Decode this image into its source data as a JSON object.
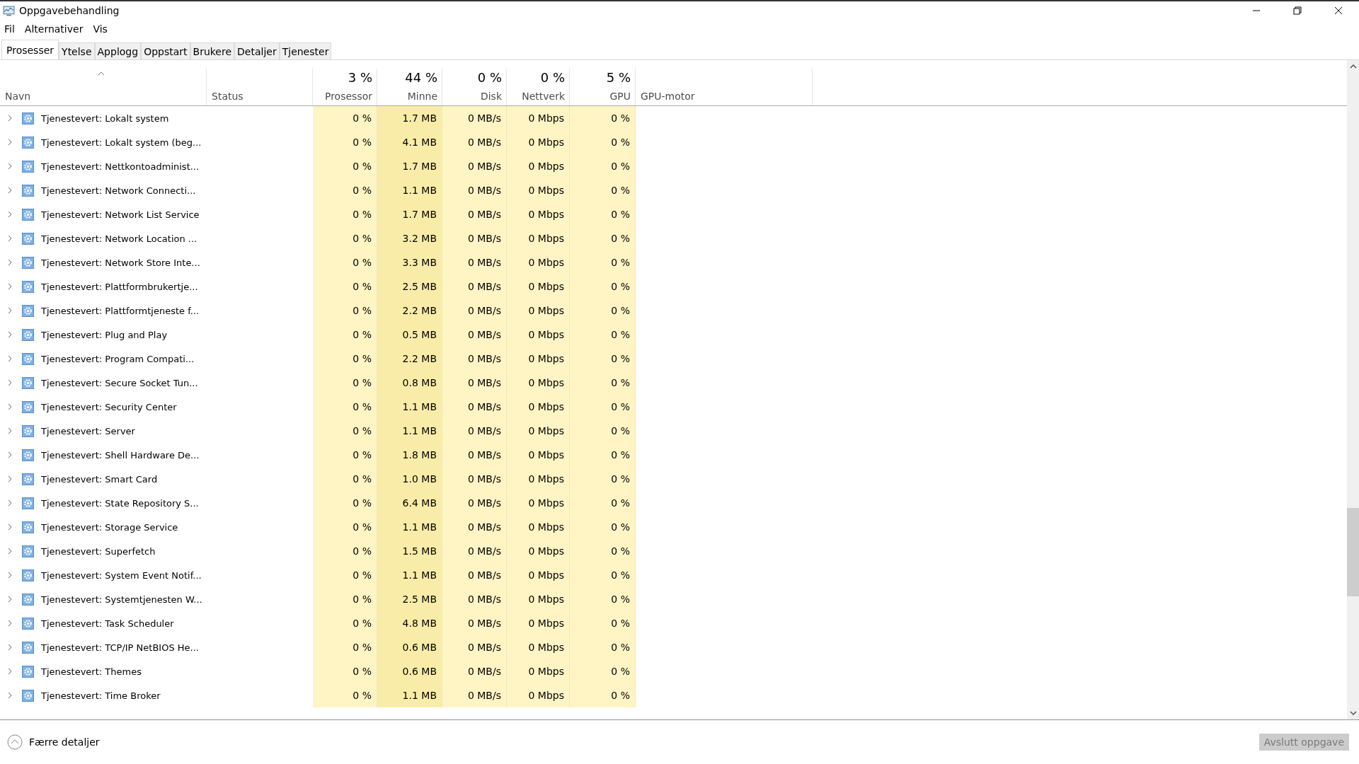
{
  "window": {
    "title": "Oppgavebehandling"
  },
  "menu": [
    "Fil",
    "Alternativer",
    "Vis"
  ],
  "tabs": [
    {
      "label": "Prosesser",
      "selected": true
    },
    {
      "label": "Ytelse",
      "selected": false
    },
    {
      "label": "Applogg",
      "selected": false
    },
    {
      "label": "Oppstart",
      "selected": false
    },
    {
      "label": "Brukere",
      "selected": false
    },
    {
      "label": "Detaljer",
      "selected": false
    },
    {
      "label": "Tjenester",
      "selected": false
    }
  ],
  "columns": [
    {
      "label": "Navn",
      "kind": "name"
    },
    {
      "label": "Status",
      "kind": "text"
    },
    {
      "usage": "3 %",
      "label": "Prosessor",
      "kind": "metric"
    },
    {
      "usage": "44 %",
      "label": "Minne",
      "kind": "metric"
    },
    {
      "usage": "0 %",
      "label": "Disk",
      "kind": "metric"
    },
    {
      "usage": "0 %",
      "label": "Nettverk",
      "kind": "metric"
    },
    {
      "usage": "5 %",
      "label": "GPU",
      "kind": "metric"
    },
    {
      "label": "GPU-motor",
      "kind": "text"
    }
  ],
  "rows": [
    {
      "name": "Tjenestevert: Lokalt system",
      "values": [
        "0 %",
        "1.7 MB",
        "0 MB/s",
        "0 Mbps",
        "0 %"
      ]
    },
    {
      "name": "Tjenestevert: Lokalt system (beg...",
      "values": [
        "0 %",
        "4.1 MB",
        "0 MB/s",
        "0 Mbps",
        "0 %"
      ]
    },
    {
      "name": "Tjenestevert: Nettkontoadminist...",
      "values": [
        "0 %",
        "1.7 MB",
        "0 MB/s",
        "0 Mbps",
        "0 %"
      ]
    },
    {
      "name": "Tjenestevert: Network Connecti...",
      "values": [
        "0 %",
        "1.1 MB",
        "0 MB/s",
        "0 Mbps",
        "0 %"
      ]
    },
    {
      "name": "Tjenestevert: Network List Service",
      "values": [
        "0 %",
        "1.7 MB",
        "0 MB/s",
        "0 Mbps",
        "0 %"
      ]
    },
    {
      "name": "Tjenestevert: Network Location ...",
      "values": [
        "0 %",
        "3.2 MB",
        "0 MB/s",
        "0 Mbps",
        "0 %"
      ]
    },
    {
      "name": "Tjenestevert: Network Store Inte...",
      "values": [
        "0 %",
        "3.3 MB",
        "0 MB/s",
        "0 Mbps",
        "0 %"
      ]
    },
    {
      "name": "Tjenestevert: Plattformbrukertje...",
      "values": [
        "0 %",
        "2.5 MB",
        "0 MB/s",
        "0 Mbps",
        "0 %"
      ]
    },
    {
      "name": "Tjenestevert: Plattformtjeneste f...",
      "values": [
        "0 %",
        "2.2 MB",
        "0 MB/s",
        "0 Mbps",
        "0 %"
      ]
    },
    {
      "name": "Tjenestevert: Plug and Play",
      "values": [
        "0 %",
        "0.5 MB",
        "0 MB/s",
        "0 Mbps",
        "0 %"
      ]
    },
    {
      "name": "Tjenestevert: Program Compati...",
      "values": [
        "0 %",
        "2.2 MB",
        "0 MB/s",
        "0 Mbps",
        "0 %"
      ]
    },
    {
      "name": "Tjenestevert: Secure Socket Tun...",
      "values": [
        "0 %",
        "0.8 MB",
        "0 MB/s",
        "0 Mbps",
        "0 %"
      ]
    },
    {
      "name": "Tjenestevert: Security Center",
      "values": [
        "0 %",
        "1.1 MB",
        "0 MB/s",
        "0 Mbps",
        "0 %"
      ]
    },
    {
      "name": "Tjenestevert: Server",
      "values": [
        "0 %",
        "1.1 MB",
        "0 MB/s",
        "0 Mbps",
        "0 %"
      ]
    },
    {
      "name": "Tjenestevert: Shell Hardware De...",
      "values": [
        "0 %",
        "1.8 MB",
        "0 MB/s",
        "0 Mbps",
        "0 %"
      ]
    },
    {
      "name": "Tjenestevert: Smart Card",
      "values": [
        "0 %",
        "1.0 MB",
        "0 MB/s",
        "0 Mbps",
        "0 %"
      ]
    },
    {
      "name": "Tjenestevert: State Repository S...",
      "values": [
        "0 %",
        "6.4 MB",
        "0 MB/s",
        "0 Mbps",
        "0 %"
      ]
    },
    {
      "name": "Tjenestevert: Storage Service",
      "values": [
        "0 %",
        "1.1 MB",
        "0 MB/s",
        "0 Mbps",
        "0 %"
      ]
    },
    {
      "name": "Tjenestevert: Superfetch",
      "values": [
        "0 %",
        "1.5 MB",
        "0 MB/s",
        "0 Mbps",
        "0 %"
      ]
    },
    {
      "name": "Tjenestevert: System Event Notif...",
      "values": [
        "0 %",
        "1.1 MB",
        "0 MB/s",
        "0 Mbps",
        "0 %"
      ]
    },
    {
      "name": "Tjenestevert: Systemtjenesten W...",
      "values": [
        "0 %",
        "2.5 MB",
        "0 MB/s",
        "0 Mbps",
        "0 %"
      ]
    },
    {
      "name": "Tjenestevert: Task Scheduler",
      "values": [
        "0 %",
        "4.8 MB",
        "0 MB/s",
        "0 Mbps",
        "0 %"
      ]
    },
    {
      "name": "Tjenestevert: TCP/IP NetBIOS He...",
      "values": [
        "0 %",
        "0.6 MB",
        "0 MB/s",
        "0 Mbps",
        "0 %"
      ]
    },
    {
      "name": "Tjenestevert: Themes",
      "values": [
        "0 %",
        "0.6 MB",
        "0 MB/s",
        "0 Mbps",
        "0 %"
      ]
    },
    {
      "name": "Tjenestevert: Time Broker",
      "values": [
        "0 %",
        "1.1 MB",
        "0 MB/s",
        "0 Mbps",
        "0 %"
      ]
    }
  ],
  "footer": {
    "toggle": "Færre detaljer",
    "end_button": {
      "label": "Avslutt oppgave",
      "disabled": true
    }
  }
}
